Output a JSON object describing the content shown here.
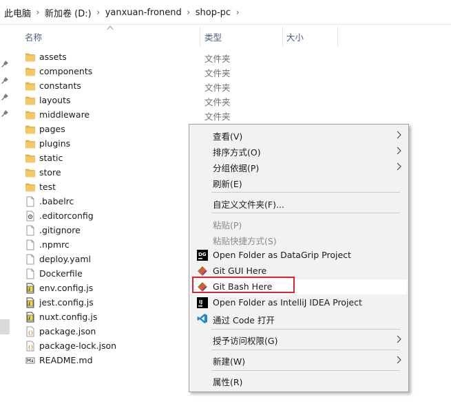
{
  "breadcrumb": [
    "此电脑",
    "新加卷 (D:)",
    "yanxuan-fronend",
    "shop-pc"
  ],
  "columns": {
    "name": "名称",
    "type": "类型",
    "size": "大小"
  },
  "files": [
    {
      "name": "assets",
      "type": "文件夹",
      "icon": "folder-icon"
    },
    {
      "name": "components",
      "type": "文件夹",
      "icon": "folder-icon"
    },
    {
      "name": "constants",
      "type": "文件夹",
      "icon": "folder-icon"
    },
    {
      "name": "layouts",
      "type": "文件夹",
      "icon": "folder-icon"
    },
    {
      "name": "middleware",
      "type": "文件夹",
      "icon": "folder-icon"
    },
    {
      "name": "pages",
      "type": "",
      "icon": "folder-icon"
    },
    {
      "name": "plugins",
      "type": "",
      "icon": "folder-icon"
    },
    {
      "name": "static",
      "type": "",
      "icon": "folder-icon"
    },
    {
      "name": "store",
      "type": "",
      "icon": "folder-icon"
    },
    {
      "name": "test",
      "type": "",
      "icon": "folder-icon"
    },
    {
      "name": ".babelrc",
      "type": "",
      "icon": "file-icon"
    },
    {
      "name": ".editorconfig",
      "type": "",
      "icon": "config-file-icon"
    },
    {
      "name": ".gitignore",
      "type": "",
      "icon": "file-icon"
    },
    {
      "name": ".npmrc",
      "type": "",
      "icon": "file-icon"
    },
    {
      "name": "deploy.yaml",
      "type": "",
      "icon": "file-icon"
    },
    {
      "name": "Dockerfile",
      "type": "",
      "icon": "file-icon"
    },
    {
      "name": "env.config.js",
      "type": "",
      "icon": "js-file-icon"
    },
    {
      "name": "jest.config.js",
      "type": "",
      "icon": "js-file-icon"
    },
    {
      "name": "nuxt.config.js",
      "type": "",
      "icon": "js-file-icon"
    },
    {
      "name": "package.json",
      "type": "",
      "icon": "json-file-icon"
    },
    {
      "name": "package-lock.json",
      "type": "",
      "icon": "json-file-icon"
    },
    {
      "name": "README.md",
      "type": "",
      "icon": "md-file-icon"
    }
  ],
  "context_menu": {
    "view": "查看(V)",
    "sort_by": "排序方式(O)",
    "group_by": "分组依据(P)",
    "refresh": "刷新(E)",
    "customize_folder": "自定义文件夹(F)...",
    "paste": "粘贴(P)",
    "paste_shortcut": "粘贴快捷方式(S)",
    "open_datagrip": "Open Folder as DataGrip Project",
    "git_gui": "Git GUI Here",
    "git_bash": "Git Bash Here",
    "open_intellij": "Open Folder as IntelliJ IDEA Project",
    "open_vscode": "通过 Code 打开",
    "grant_access": "授予访问权限(G)",
    "new": "新建(W)",
    "properties": "属性(R)"
  },
  "colors": {
    "folder": "#e8b64c",
    "highlight_border": "#e0202a",
    "header_text": "#4d6082",
    "menu_bg": "#f2f2f2"
  }
}
